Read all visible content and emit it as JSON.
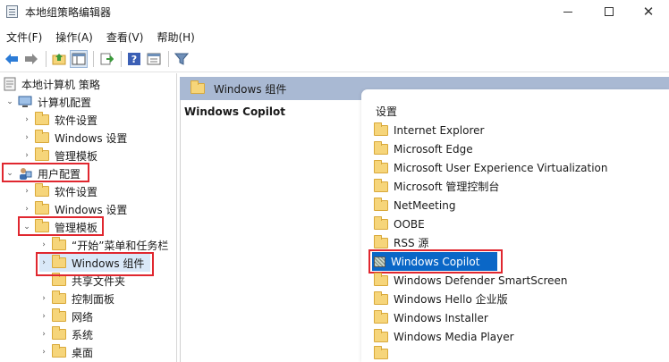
{
  "window": {
    "title": "本地组策略编辑器"
  },
  "menu": [
    "文件(F)",
    "操作(A)",
    "查看(V)",
    "帮助(H)"
  ],
  "toolbar": {
    "buttons": [
      "back-arrow-icon",
      "forward-arrow-icon",
      "up-folder-icon",
      "show-hide-tree-icon",
      "export-list-icon",
      "help-icon",
      "properties-icon",
      "filter-icon"
    ]
  },
  "tree": {
    "root": "本地计算机 策略",
    "computer_config": "计算机配置",
    "cc_software": "软件设置",
    "cc_windows": "Windows 设置",
    "cc_admin": "管理模板",
    "user_config": "用户配置",
    "uc_software": "软件设置",
    "uc_windows": "Windows 设置",
    "uc_admin": "管理模板",
    "start_menu": "“开始”菜单和任务栏",
    "windows_components": "Windows 组件",
    "shared_folders": "共享文件夹",
    "control_panel": "控制面板",
    "network": "网络",
    "system": "系统",
    "desktop": "桌面"
  },
  "right": {
    "header": "Windows 组件",
    "policy_title": "Windows Copilot",
    "settings_header": "设置",
    "settings": [
      "Internet Explorer",
      "Microsoft Edge",
      "Microsoft User Experience Virtualization",
      "Microsoft 管理控制台",
      "NetMeeting",
      "OOBE",
      "RSS 源",
      "Windows Copilot",
      "Windows Defender SmartScreen",
      "Windows Hello 企业版",
      "Windows Installer",
      "Windows Media Player"
    ],
    "selected_setting": "Windows Copilot"
  },
  "colors": {
    "highlight_box": "#e0272f",
    "selection_blue": "#0a67c7",
    "header_bar": "#a9b9d3",
    "folder_yellow": "#f6d57a"
  }
}
